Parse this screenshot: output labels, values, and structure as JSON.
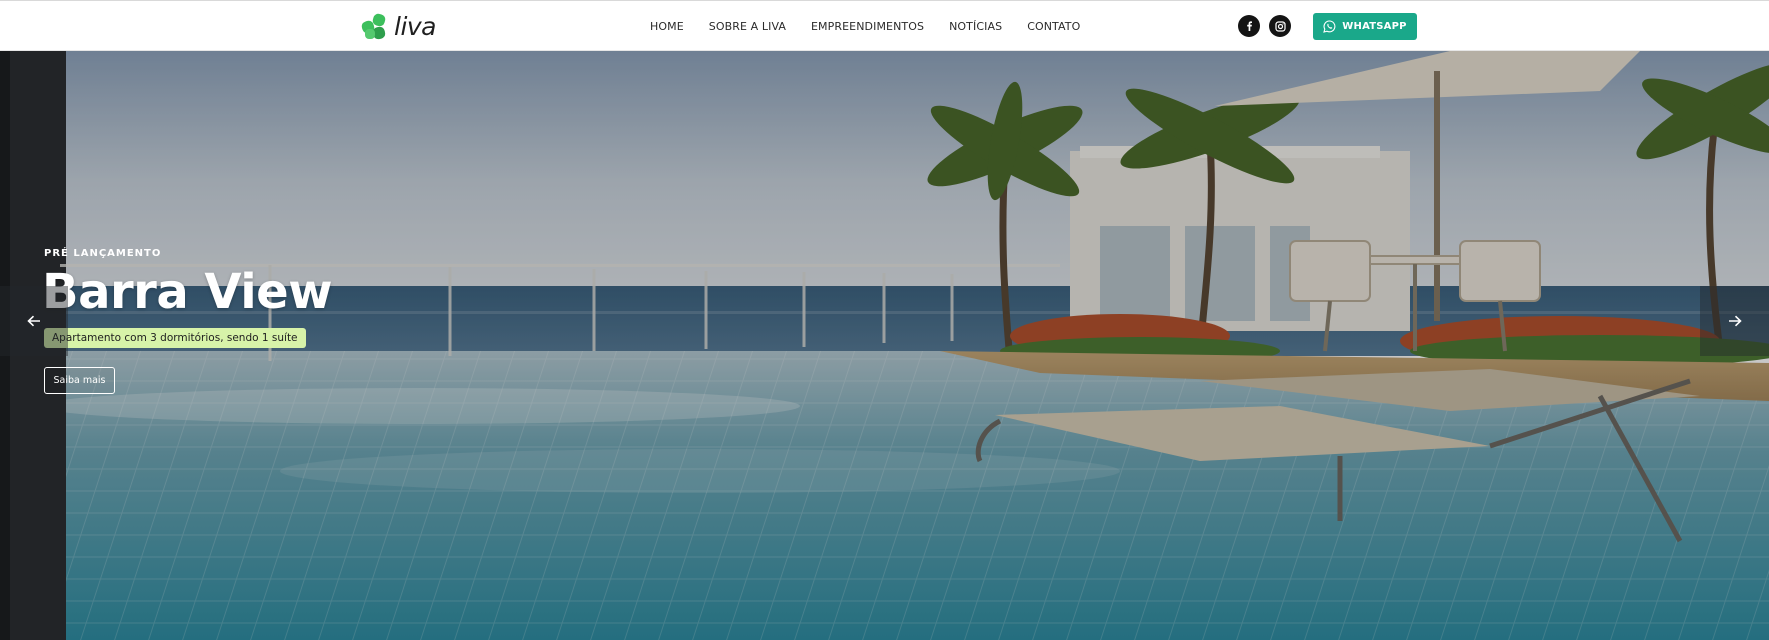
{
  "brand": {
    "name": "liva",
    "logo_color": "#3cbf5c"
  },
  "nav": {
    "items": [
      {
        "label": "HOME"
      },
      {
        "label": "SOBRE A LIVA"
      },
      {
        "label": "EMPREENDIMENTOS"
      },
      {
        "label": "NOTÍCIAS"
      },
      {
        "label": "CONTATO"
      }
    ]
  },
  "social": {
    "facebook_icon": "facebook-icon",
    "instagram_icon": "instagram-icon"
  },
  "whatsapp": {
    "label": "WHATSAPP",
    "color": "#1aa88a",
    "icon": "whatsapp-icon"
  },
  "hero": {
    "eyebrow": "PRÉ LANÇAMENTO",
    "title": "Barra View",
    "subtitle": "Apartamento com 3 dormitórios, sendo 1 suíte",
    "cta": "Saiba mais",
    "badge_color": "#d7f3a9",
    "prev_icon": "arrow-left-icon",
    "next_icon": "arrow-right-icon"
  }
}
